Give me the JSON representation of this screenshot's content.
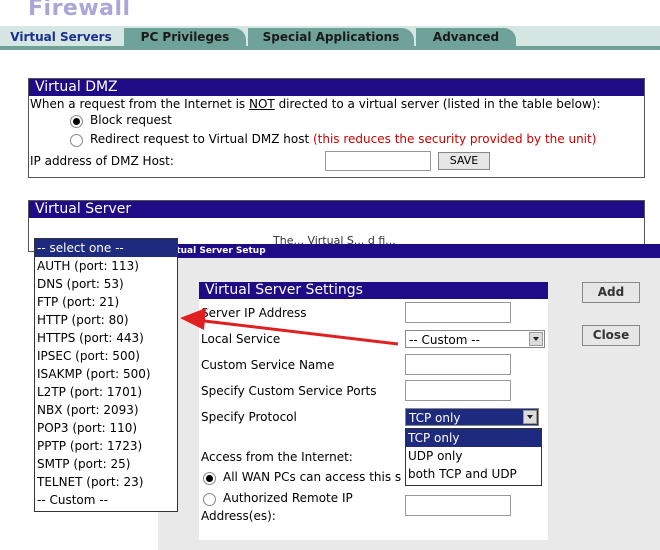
{
  "page": {
    "title": "Firewall"
  },
  "tabs": [
    {
      "label": "Virtual Servers"
    },
    {
      "label": "PC Privileges"
    },
    {
      "label": "Special Applications"
    },
    {
      "label": "Advanced"
    }
  ],
  "dmz": {
    "header": "Virtual DMZ",
    "intro_before": "When a request from the Internet is ",
    "intro_not": "NOT",
    "intro_after": " directed to a virtual server (listed in the table below):",
    "option_block": "Block request",
    "option_redirect": "Redirect request to Virtual DMZ host",
    "redirect_warning": "(this reduces the security provided by the unit)",
    "ip_label": "IP address of DMZ Host:",
    "ip_value": "",
    "save_label": "SAVE",
    "selected_option": "block"
  },
  "virtual_server": {
    "header": "Virtual Server",
    "partial_text": "The... Virtual S... d fi..."
  },
  "setup_window": {
    "title": "Virtual Server Setup",
    "settings_header": "Virtual Server Settings",
    "server_ip_label": "Server IP Address",
    "server_ip_value": "",
    "local_service_label": "Local Service",
    "local_service_value": "-- Custom --",
    "custom_name_label": "Custom Service Name",
    "custom_name_value": "",
    "custom_ports_label": "Specify Custom Service Ports",
    "custom_ports_value": "",
    "protocol_label": "Specify Protocol",
    "protocol_value": "TCP only",
    "protocol_options": [
      "TCP only",
      "UDP only",
      "both TCP and UDP"
    ],
    "access_label": "Access from the Internet:",
    "access_all": "All WAN PCs can access this s",
    "access_authorized_1": "Authorized Remote IP",
    "access_authorized_2": "Address(es):",
    "authorized_value": "",
    "add_label": "Add",
    "close_label": "Close"
  },
  "service_list": [
    "-- select one --",
    "AUTH (port: 113)",
    "DNS (port: 53)",
    "FTP (port: 21)",
    "HTTP (port: 80)",
    "HTTPS (port: 443)",
    "IPSEC (port: 500)",
    "ISAKMP (port: 500)",
    "L2TP (port: 1701)",
    "NBX (port: 2093)",
    "POP3 (port: 110)",
    "PPTP (port: 1723)",
    "SMTP (port: 25)",
    "TELNET (port: 23)",
    "-- Custom --"
  ],
  "colors": {
    "header": "#1f0b86",
    "tab": "#6fa39a",
    "tab_active_bg": "#d6e6e3",
    "warning": "#cc0000",
    "arrow": "#e02020"
  }
}
